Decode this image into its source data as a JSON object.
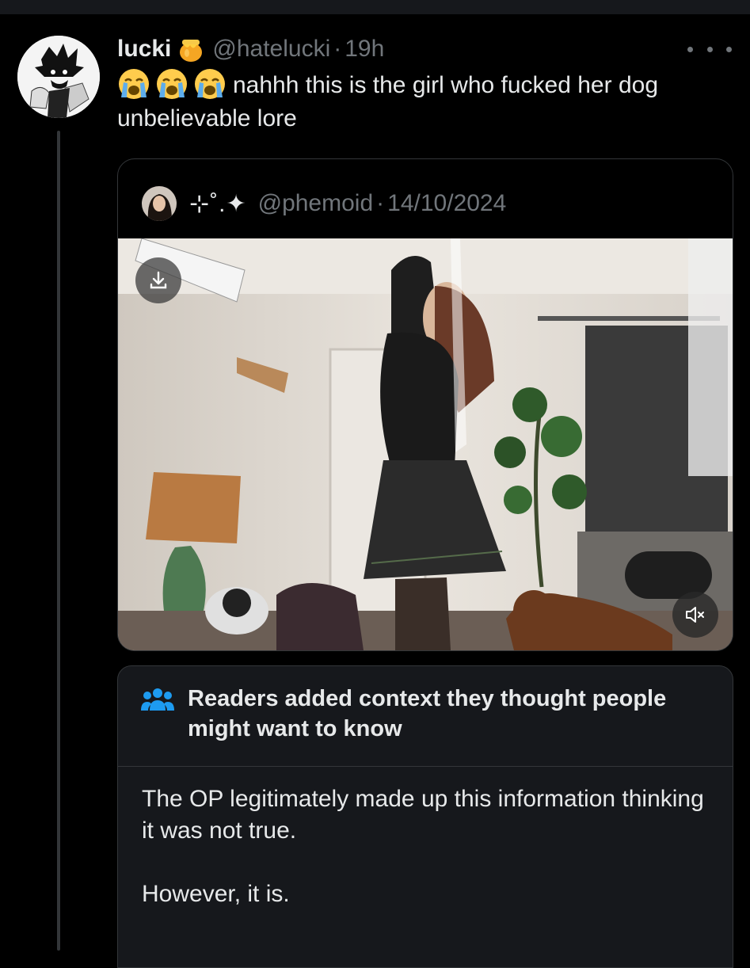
{
  "tweet": {
    "display_name": "lucki",
    "name_emoji": "honey-pot-icon",
    "handle": "@hatelucki",
    "separator": "·",
    "time": "19h",
    "emojis": [
      "loudly-crying-face-icon",
      "loudly-crying-face-icon",
      "loudly-crying-face-icon"
    ],
    "text": "nahhh this is the girl who fucked her dog unbelievable lore"
  },
  "quote": {
    "display_name": "⊹˚.✦",
    "handle": "@phemoid",
    "separator": "·",
    "date": "14/10/2024",
    "media": {
      "type": "video",
      "controls": [
        "download-icon",
        "mute-icon"
      ]
    }
  },
  "community_note": {
    "icon": "people-icon",
    "title": "Readers added context they thought people might want to know",
    "body": [
      "The OP legitimately made up this information thinking it was not true.",
      "However, it is."
    ]
  },
  "colors": {
    "background": "#000000",
    "text": "#e7e9ea",
    "secondary_text": "#71767b",
    "border": "#333639",
    "note_background": "#16181c",
    "note_icon": "#1d9bf0"
  }
}
